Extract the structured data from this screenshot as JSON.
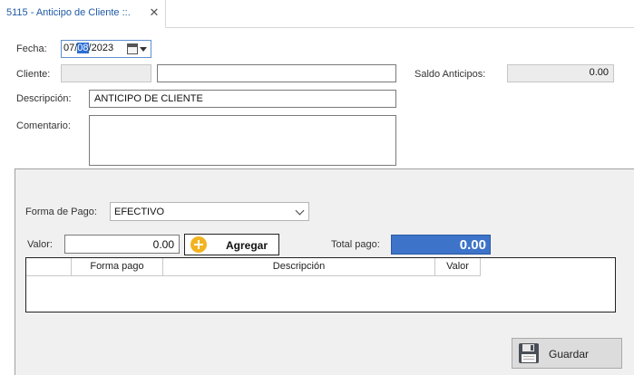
{
  "tab": {
    "title": "5115 - Anticipo de Cliente ::.",
    "close_glyph": "✕"
  },
  "form": {
    "fecha_label": "Fecha:",
    "fecha_prefix": "07/",
    "fecha_selected": "08",
    "fecha_suffix": "/2023",
    "cliente_label": "Cliente:",
    "cliente_code": "",
    "cliente_name": "",
    "saldo_label": "Saldo Anticipos:",
    "saldo_value": "0.00",
    "descripcion_label": "Descripción:",
    "descripcion_value": "ANTICIPO DE CLIENTE",
    "comentario_label": "Comentario:",
    "comentario_value": ""
  },
  "payment": {
    "forma_label": "Forma de Pago:",
    "forma_value": "EFECTIVO",
    "valor_label": "Valor:",
    "valor_value": "0.00",
    "agregar_label": "Agregar",
    "total_label": "Total pago:",
    "total_value": "0.00"
  },
  "grid": {
    "columns": [
      "",
      "Forma pago",
      "Descripción",
      "Valor"
    ]
  },
  "actions": {
    "guardar_label": "Guardar"
  },
  "icons": {
    "calendar": "calendar-icon",
    "dropdown": "chevron-down-icon",
    "add": "plus-circle-icon",
    "save": "floppy-disk-icon"
  },
  "colors": {
    "accent": "#3d74c9",
    "tab_text": "#1f5aa6",
    "add_icon": "#f2b320"
  }
}
